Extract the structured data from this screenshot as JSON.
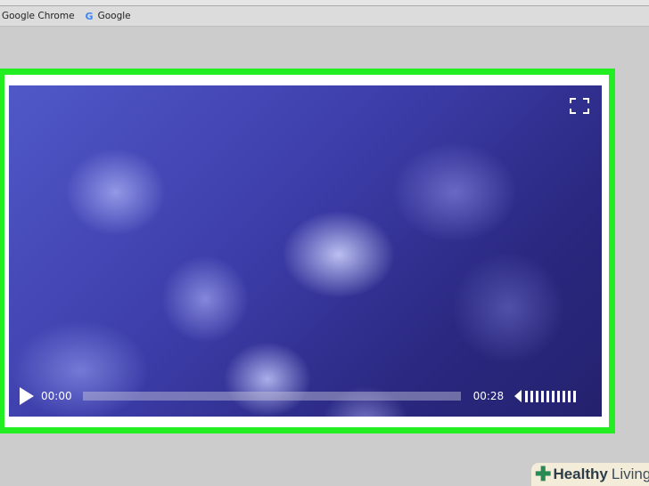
{
  "browser": {
    "bookmarks": [
      {
        "label": "n Google Chrome"
      },
      {
        "label": "Google",
        "icon": "google-icon"
      }
    ]
  },
  "player": {
    "current_time": "00:00",
    "duration": "00:28",
    "progress": 0,
    "volume_bars": 10,
    "icons": [
      "play-icon",
      "fullscreen-icon",
      "volume-icon"
    ]
  },
  "highlight_color": "#22ee22",
  "logo": {
    "text": "Healthy Living"
  }
}
